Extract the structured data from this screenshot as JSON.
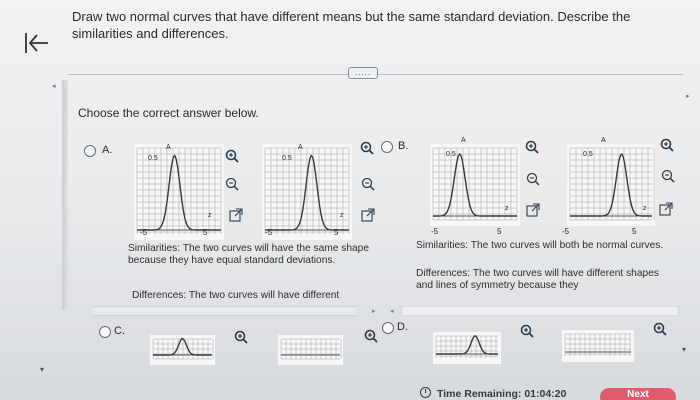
{
  "question": {
    "text": "Draw two normal curves that have different means but the same standard deviation. Describe the similarities and differences."
  },
  "more_button": {
    "label": "....."
  },
  "prompt": {
    "text": "Choose the correct answer below."
  },
  "options": {
    "a": {
      "letter": "A.",
      "graph_labels": {
        "y_axis": "A",
        "y_mark": "0.5",
        "x_min": "-5",
        "x_max": "5",
        "x_axis": "z"
      },
      "similarities": "Similarities: The two curves will have the same shape because they have equal standard deviations.",
      "differences": "Differences: The two curves will have different"
    },
    "b": {
      "letter": "B.",
      "graph_labels": {
        "y_axis": "A",
        "y_mark": "0.5",
        "x_min": "-5",
        "x_max": "5",
        "x_axis": "z"
      },
      "similarities": "Similarities: The two curves will both be normal curves.",
      "differences": "Differences: The two curves will have different shapes and lines of symmetry because they"
    },
    "c": {
      "letter": "C."
    },
    "d": {
      "letter": "D."
    }
  },
  "timer": {
    "label": "Time Remaining:",
    "value": "01:04:20"
  },
  "next_button": {
    "label": "Next"
  },
  "colors": {
    "curve": "#3a3a3a",
    "grid": "#9ea3a8",
    "tool_icon": "#2f3e4d",
    "next": "#e05b6b"
  },
  "icons": {
    "back": "back-to-start-icon",
    "zoom_in": "zoom-in-icon",
    "zoom_out": "zoom-out-icon",
    "expand": "expand-icon",
    "clock": "clock-icon"
  }
}
